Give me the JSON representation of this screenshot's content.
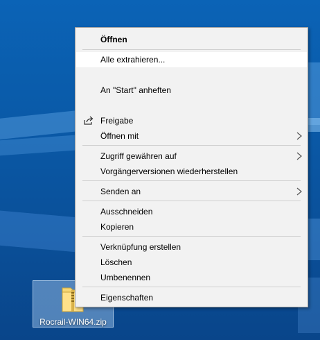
{
  "desktop": {
    "file": {
      "name": "Rocrail-WIN64.zip",
      "icon": "zip-folder-icon"
    }
  },
  "context_menu": {
    "items": [
      {
        "label": "Öffnen",
        "bold": true
      },
      {
        "label": "Alle extrahieren..."
      },
      {
        "label": "An \"Start\" anheften"
      },
      {
        "label": "Freigabe",
        "icon": "share-icon"
      },
      {
        "label": "Öffnen mit",
        "submenu": true
      },
      {
        "label": "Zugriff gewähren auf",
        "submenu": true
      },
      {
        "label": "Vorgängerversionen wiederherstellen"
      },
      {
        "label": "Senden an",
        "submenu": true
      },
      {
        "label": "Ausschneiden"
      },
      {
        "label": "Kopieren"
      },
      {
        "label": "Verknüpfung erstellen"
      },
      {
        "label": "Löschen"
      },
      {
        "label": "Umbenennen"
      },
      {
        "label": "Eigenschaften"
      }
    ]
  },
  "colors": {
    "menu_background": "#f2f2f2",
    "hover_background": "#ffffff",
    "separator": "#cfcfcf",
    "desktop_blue": "#0a5aa8"
  }
}
